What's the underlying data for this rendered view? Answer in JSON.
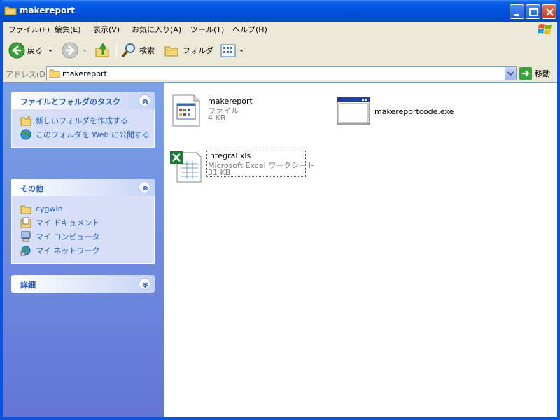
{
  "window": {
    "title": "makereport"
  },
  "menu": {
    "items": [
      "ファイル(F)",
      "編集(E)",
      "表示(V)",
      "お気に入り(A)",
      "ツール(T)",
      "ヘルプ(H)"
    ]
  },
  "toolbar": {
    "back_label": "戻る",
    "search_label": "検索",
    "folders_label": "フォルダ"
  },
  "address": {
    "label": "アドレス(D)",
    "value": "makereport",
    "go_label": "移動"
  },
  "taskpane": {
    "tasks": {
      "title": "ファイルとフォルダのタスク",
      "links": [
        "新しいフォルダを作成する",
        "このフォルダを Web に公開する"
      ]
    },
    "other": {
      "title": "その他",
      "links": [
        "cygwin",
        "マイ ドキュメント",
        "マイ コンピュータ",
        "マイ ネットワーク"
      ]
    },
    "details": {
      "title": "詳細"
    }
  },
  "files": [
    {
      "name": "makereport",
      "type": "ファイル",
      "size": "4 KB",
      "icon": "generic-file-icon"
    },
    {
      "name": "makereportcode.exe",
      "type": "",
      "size": "",
      "icon": "application-icon"
    },
    {
      "name": "integral.xls",
      "type": "Microsoft Excel ワークシート",
      "size": "31 KB",
      "icon": "excel-file-icon"
    }
  ]
}
